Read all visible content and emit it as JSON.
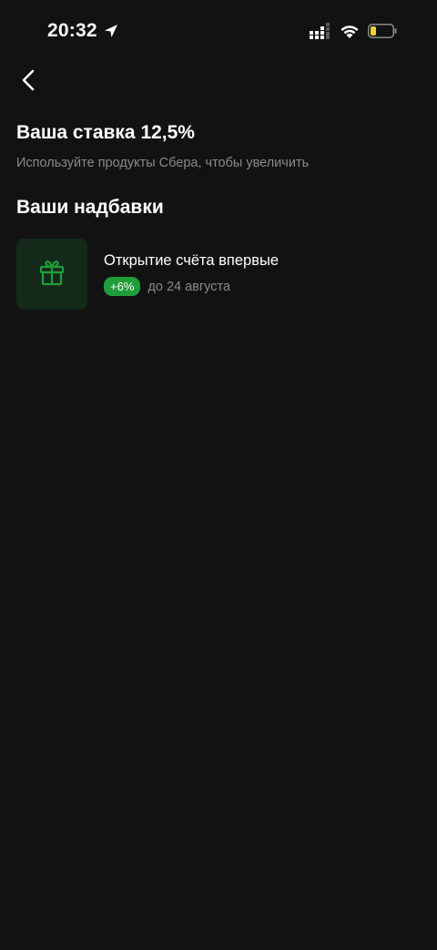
{
  "status_bar": {
    "time": "20:32",
    "icons": [
      "location-arrow-icon",
      "cellular-signal-icon",
      "wifi-icon",
      "battery-low-icon"
    ],
    "battery_color": "#f5d130"
  },
  "header": {
    "back_icon": "chevron-left-icon"
  },
  "rate": {
    "title": "Ваша ставка 12,5%",
    "subtitle": "Используйте продукты Сбера, чтобы увеличить"
  },
  "bonuses": {
    "title": "Ваши надбавки",
    "items": [
      {
        "icon": "gift-icon",
        "name": "Открытие счёта впервые",
        "badge": "+6%",
        "date": "до 24 августа"
      }
    ]
  },
  "colors": {
    "background": "#121212",
    "accent_green": "#1f9d3a",
    "icon_tile": "#14291a",
    "secondary_text": "#8a8a8a"
  }
}
